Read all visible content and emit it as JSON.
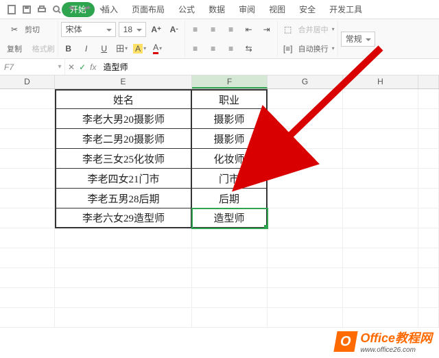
{
  "quick_icons": [
    "blank-icon",
    "save-icon",
    "saveas-icon",
    "print-icon",
    "preview-icon",
    "undo-icon",
    "redo-icon"
  ],
  "tabs": [
    "开始",
    "插入",
    "页面布局",
    "公式",
    "数据",
    "审阅",
    "视图",
    "安全",
    "开发工具"
  ],
  "tab_active": "开始",
  "ribbon": {
    "clipboard": {
      "cut": "剪切",
      "copy": "复制",
      "format": "格式刷"
    },
    "font": {
      "name": "宋体",
      "size": "18",
      "grow": "A⁺",
      "shrink": "A⁻",
      "bold": "B",
      "italic": "I",
      "underline": "U",
      "morefont": "A"
    },
    "align": {
      "merge": "合并居中",
      "wrap": "自动换行"
    },
    "number": {
      "general": "常规"
    }
  },
  "formula_bar": {
    "namebox": "F7",
    "value": "造型师",
    "fx": "fx"
  },
  "columns": [
    "D",
    "E",
    "F",
    "G",
    "H"
  ],
  "active_col": "F",
  "table": {
    "header": {
      "e": "姓名",
      "f": "职业"
    },
    "rows": [
      {
        "e": "李老大男20摄影师",
        "f": "摄影师"
      },
      {
        "e": "李老二男20摄影师",
        "f": "摄影师"
      },
      {
        "e": "李老三女25化妆师",
        "f": "化妆师"
      },
      {
        "e": "李老四女21门市",
        "f": "门市"
      },
      {
        "e": "李老五男28后期",
        "f": "后期"
      },
      {
        "e": "李老六女29造型师",
        "f": "造型师"
      }
    ]
  },
  "active_row_index": 5,
  "watermark": {
    "title": "Office教程网",
    "url": "www.office26.com"
  }
}
